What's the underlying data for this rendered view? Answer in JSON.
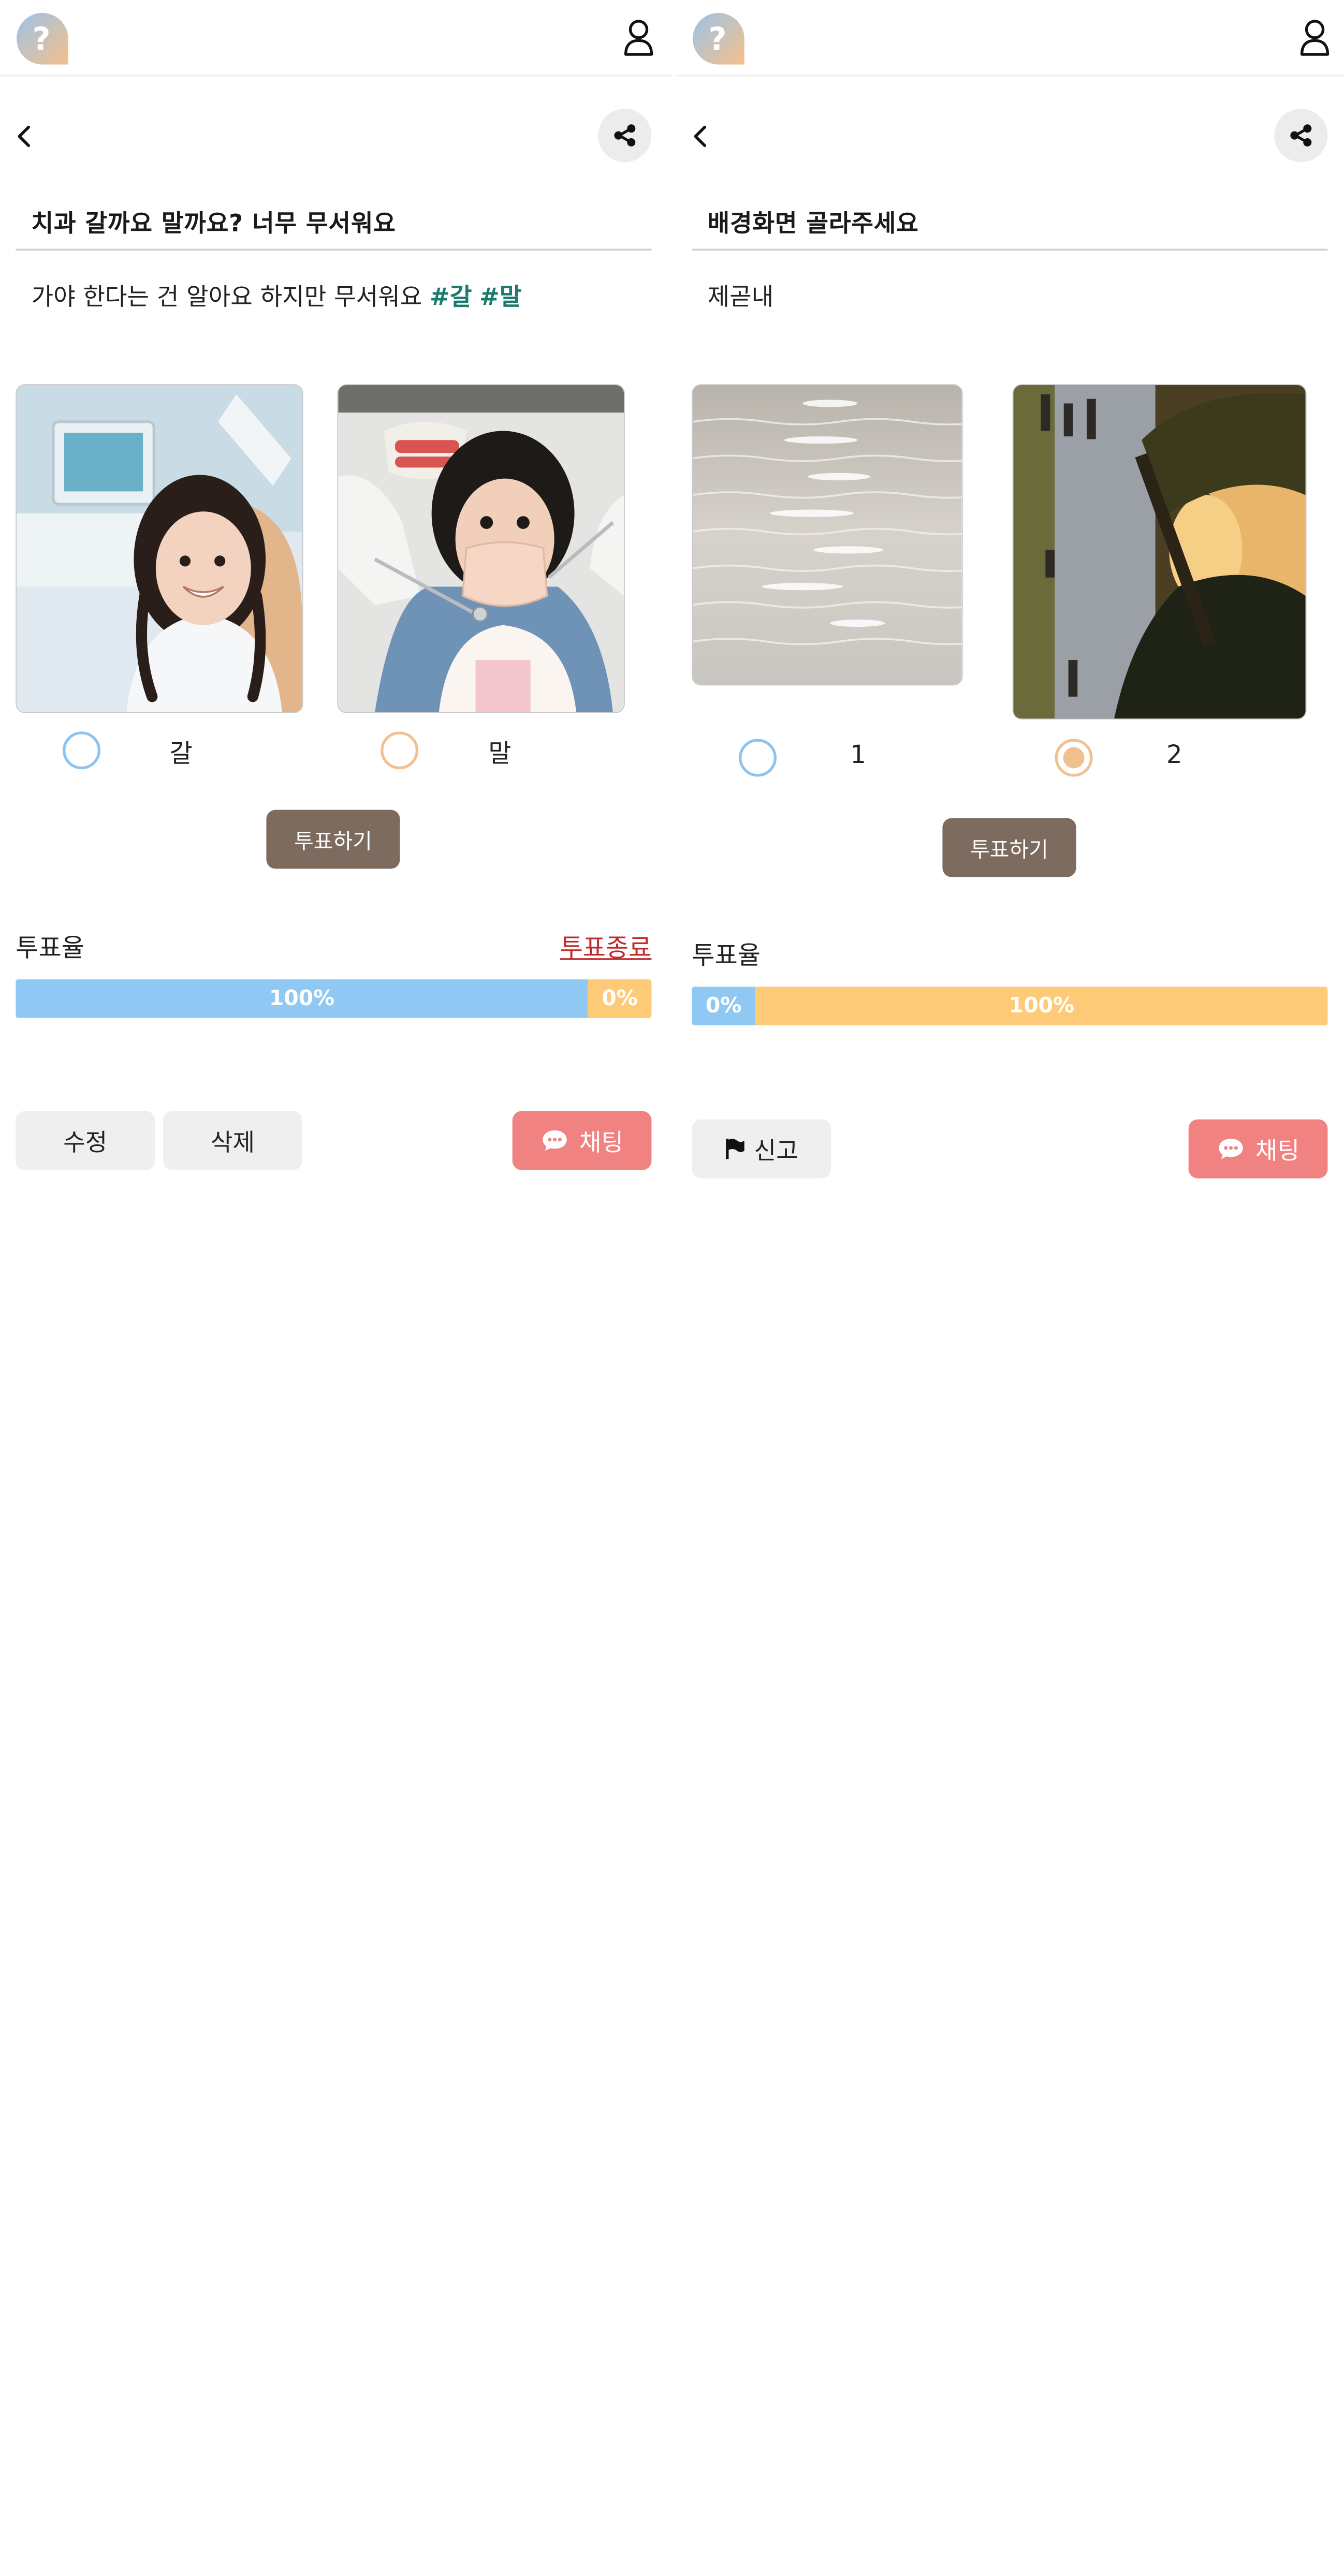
{
  "screens": [
    {
      "title": "치과 갈까요 말까요? 너무 무서워요",
      "description": "가야 한다는 건 알아요 하지만 무서워요",
      "hashtags": [
        "#갈",
        "#말"
      ],
      "options": [
        {
          "label": "갈",
          "image": "smiling-girl-dental-chair",
          "radio_color": "#8dc3ef",
          "selected": false
        },
        {
          "label": "말",
          "image": "scared-girl-dental-tools",
          "radio_color": "#f0c08e",
          "selected": false
        }
      ],
      "vote_button": "투표하기",
      "rate_label": "투표율",
      "end_link": "투표종료",
      "results": [
        {
          "label": "100%",
          "share": 0.9,
          "color": "#90c8f4"
        },
        {
          "label": "0%",
          "share": 0.1,
          "color": "#fdca78"
        }
      ],
      "actions": {
        "edit": "수정",
        "delete": "삭제",
        "chat": "채팅"
      }
    },
    {
      "title": "배경화면 골라주세요",
      "description": "제곧내",
      "options": [
        {
          "label": "1",
          "image": "sunlit-water-surface",
          "radio_color": "#8dc3ef",
          "selected": false
        },
        {
          "label": "2",
          "image": "park-sunset-tree-rotated",
          "radio_color": "#f0c08e",
          "selected": true
        }
      ],
      "vote_button": "투표하기",
      "rate_label": "투표율",
      "results": [
        {
          "label": "0%",
          "share": 0.1,
          "color": "#90c8f4"
        },
        {
          "label": "100%",
          "share": 0.9,
          "color": "#fdca78"
        }
      ],
      "actions": {
        "report": "신고",
        "chat": "채팅"
      }
    }
  ],
  "icons": {
    "logo": "question-mark-logo-icon",
    "profile": "user-icon",
    "back": "chevron-left-icon",
    "share": "share-icon",
    "chat": "chat-bubble-icon",
    "report": "flag-icon"
  },
  "colors": {
    "accent_brown": "#7e6b5f",
    "chat_pink": "#f08282",
    "bar_blue": "#90c8f4",
    "bar_orange": "#fdca78",
    "hashtag_green": "#1d7a6e",
    "end_red": "#c12a2a"
  }
}
